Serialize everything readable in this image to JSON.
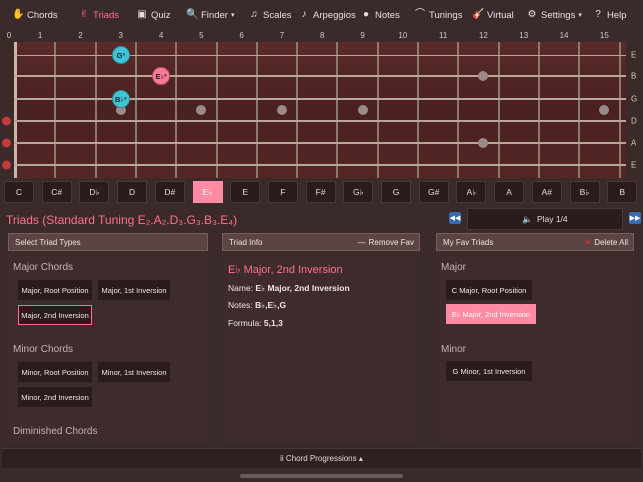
{
  "nav": {
    "items": [
      {
        "label": "Chords",
        "icon": "hand-icon",
        "glyph": "✋",
        "active": false,
        "caret": false
      },
      {
        "label": "Triads",
        "icon": "fingers-icon",
        "glyph": "✌",
        "active": true,
        "caret": false
      },
      {
        "label": "Quiz",
        "icon": "quiz-icon",
        "glyph": "▣",
        "active": false,
        "caret": false
      },
      {
        "label": "Finder",
        "icon": "magnifier-icon",
        "glyph": "🔍",
        "active": false,
        "caret": true
      },
      {
        "label": "Scales",
        "icon": "scales-icon",
        "glyph": "♫",
        "active": false,
        "caret": false
      },
      {
        "label": "Arpeggios",
        "icon": "arpeggio-icon",
        "glyph": "♪",
        "active": false,
        "caret": false
      },
      {
        "label": "Notes",
        "icon": "notes-icon",
        "glyph": "●",
        "active": false,
        "caret": false
      },
      {
        "label": "Tunings",
        "icon": "tuning-icon",
        "glyph": "⌒",
        "active": false,
        "caret": false
      },
      {
        "label": "Virtual",
        "icon": "guitar-icon",
        "glyph": "🎸",
        "active": false,
        "caret": false
      },
      {
        "label": "Settings",
        "icon": "gear-icon",
        "glyph": "⚙",
        "active": false,
        "caret": true
      },
      {
        "label": "Help",
        "icon": "help-icon",
        "glyph": "?",
        "active": false,
        "caret": false
      }
    ]
  },
  "fretboard": {
    "fret_numbers": [
      "0",
      "1",
      "2",
      "3",
      "4",
      "5",
      "6",
      "7",
      "8",
      "9",
      "10",
      "11",
      "12",
      "13",
      "14",
      "15"
    ],
    "string_names": [
      "E",
      "B",
      "G",
      "D",
      "A",
      "E"
    ],
    "inlay_frets": [
      3,
      5,
      7,
      9,
      15
    ],
    "double_inlay_fret": 12,
    "notes": [
      {
        "label": "G³",
        "fret": 3,
        "string": 0,
        "color": "#3ec6d6"
      },
      {
        "label": "E♭³",
        "fret": 4,
        "string": 1,
        "color": "#ff7a9a"
      },
      {
        "label": "B♭³",
        "fret": 3,
        "string": 2,
        "color": "#3ec6d6"
      }
    ]
  },
  "note_selector": {
    "notes": [
      "C",
      "C#",
      "D♭",
      "D",
      "D#",
      "E♭",
      "E",
      "F",
      "F#",
      "G♭",
      "G",
      "G#",
      "A♭",
      "A",
      "A#",
      "B♭",
      "B"
    ],
    "active_index": 5
  },
  "header": {
    "title": "Triads (Standard Tuning E₂.A₂.D₃.G₃.B₃.E₄)",
    "play_label": "Play 1/4",
    "prev_icon": "rewind-icon",
    "next_icon": "fast-forward-icon"
  },
  "left_panel": {
    "title": "Select Triad Types",
    "major_label": "Major Chords",
    "major_buttons": [
      "Major, Root Position",
      "Major, 1st Inversion",
      "Major, 2nd Inversion"
    ],
    "minor_label": "Minor Chords",
    "minor_buttons": [
      "Minor, Root Position",
      "Minor, 1st Inversion",
      "Minor, 2nd Inversion"
    ],
    "diminished_label": "Diminished Chords"
  },
  "info_panel": {
    "title": "Triad Info",
    "remove_fav": "Remove Fav",
    "name": "E♭ Major, 2nd Inversion",
    "name_label": "Name:",
    "name_value": "E♭ Major, 2nd Inversion",
    "notes_label": "Notes:",
    "notes_value": "B♭,E♭,G",
    "formula_label": "Formula:",
    "formula_value": "5,1,3"
  },
  "fav_panel": {
    "title": "My Fav Triads",
    "delete_all": "Delete All",
    "major_label": "Major",
    "major_items": [
      "C Major, Root Position",
      "E♭ Major, 2nd Inversion"
    ],
    "minor_label": "Minor",
    "minor_items": [
      "G Minor, 1st Inversion"
    ]
  },
  "bottom": {
    "label": "ii Chord Progressions ▴"
  }
}
